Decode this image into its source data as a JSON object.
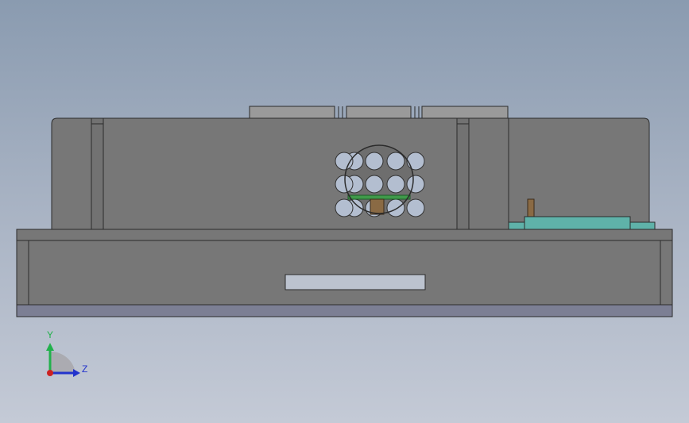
{
  "viewport": {
    "view_orientation": "right",
    "background_gradient": [
      "#8a9bb0",
      "#c4cad6"
    ]
  },
  "colors": {
    "body_gray": "#777777",
    "edge": "#2b2b2b",
    "top_cap": "#9a9a9a",
    "base_strip": "#7c7f94",
    "label_plate": "#bcc3cf",
    "fan_hole": "#b3bed0",
    "pcb_green": "#3f9a4a",
    "connector_teal": "#5fb2a9",
    "standoff_brown": "#8a6a44"
  },
  "triad": {
    "y_label": "Y",
    "z_label": "Z",
    "y_color": "#22b14c",
    "z_color": "#2233cc",
    "x_color": "#cc2222"
  }
}
